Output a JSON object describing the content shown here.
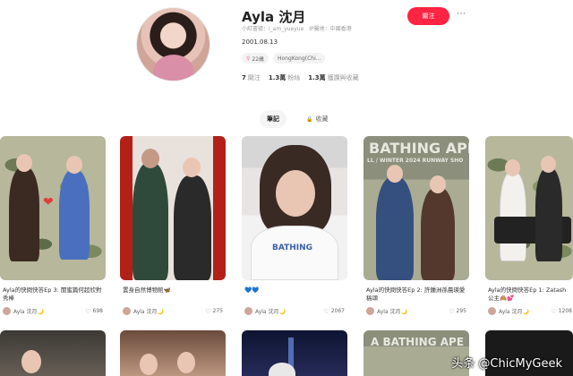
{
  "profile": {
    "name": "Ayla 沈月",
    "moon_icon": "🌙",
    "meta": [
      "小紅書號：i_am_yueyue",
      "IP屬地：中國香港"
    ],
    "birthday": "2001.08.13",
    "tags": [
      {
        "icon": "gender-female-icon",
        "icon_glyph": "♀",
        "label": "22歲"
      },
      {
        "icon": "location-icon",
        "icon_glyph": "",
        "label": "HongKong(Chi..."
      }
    ],
    "stats": [
      {
        "value": "7",
        "label": "關注"
      },
      {
        "value": "1.3萬",
        "label": "粉絲"
      },
      {
        "value": "1.3萬",
        "label": "獲讚與收藏"
      }
    ],
    "follow_label": "關注",
    "more_icon": "⋯"
  },
  "tabs": [
    {
      "label": "筆記",
      "active": true,
      "icon_glyph": ""
    },
    {
      "label": "收藏",
      "active": false,
      "icon_glyph": "🔒"
    }
  ],
  "notes": [
    {
      "title": "Ayla的快問快答Ep 3: 閨蜜篇何超欣對秀棒",
      "author": "Ayla 沈月🌙",
      "likes": "698"
    },
    {
      "title": "置身自然博物館🦋",
      "author": "Ayla 沈月🌙",
      "likes": "275"
    },
    {
      "title": "💙💙",
      "author": "Ayla 沈月🌙",
      "likes": "2067"
    },
    {
      "title": "Ayla的快問快答Ep 2: 許鍾洲孫晨瑛愛稿頌",
      "author": "Ayla 沈月🌙",
      "likes": "295"
    },
    {
      "title": "Ayla的快問快答Ep 1: Zatash 公主🙈💕",
      "author": "Ayla 沈月🌙",
      "likes": "1208"
    }
  ],
  "overlays": {
    "bathing": "BATHING APE",
    "runway": "LL / WINTER 2024 RUNWAY SHO",
    "a_bathing": "A BATHING APE"
  },
  "watermark": "头条 @ChicMyGeek"
}
